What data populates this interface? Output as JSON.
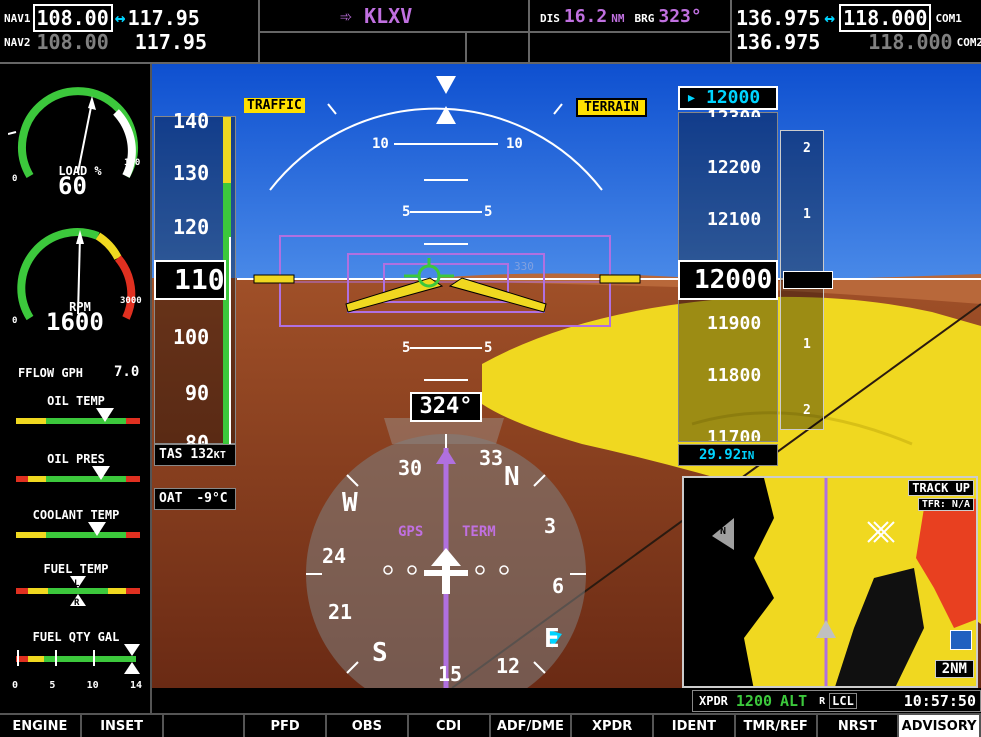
{
  "topbar": {
    "nav1_label": "NAV1",
    "nav1_active": "108.00",
    "nav1_standby": "117.95",
    "nav2_label": "NAV2",
    "nav2_active": "108.00",
    "nav2_standby": "117.95",
    "swap_arrow": "↔",
    "waypoint_arrow": "➾",
    "waypoint": "KLXV",
    "dis_label": "DIS",
    "dis_value": "16.2",
    "dis_unit": "NM",
    "brg_label": "BRG",
    "brg_value": "323°",
    "com1_standby": "136.975",
    "com1_active": "118.000",
    "com1_label": "COM1",
    "com2_standby": "136.975",
    "com2_active": "118.000",
    "com2_label": "COM2"
  },
  "engine": {
    "load_label": "LOAD %",
    "load_value": "60",
    "load_min": "0",
    "load_max": "100",
    "load_fraction": 0.6,
    "rpm_label": "RPM",
    "rpm_value": "1600",
    "rpm_min": "0",
    "rpm_max": "3000",
    "rpm_fraction": 0.53,
    "fflow_label": "FFLOW GPH",
    "fflow_value": "7.0",
    "oil_temp_label": "OIL TEMP",
    "oil_pres_label": "OIL PRES",
    "coolant_label": "COOLANT TEMP",
    "fuel_temp_label": "FUEL TEMP",
    "fuel_qty_label": "FUEL QTY GAL",
    "fuel_ticks": [
      "0",
      "5",
      "10",
      "14"
    ],
    "left_tank": "L",
    "right_tank": "R"
  },
  "pfd": {
    "traffic_label": "TRAFFIC",
    "terrain_label": "TERRAIN",
    "airspeed": "110",
    "airspeed_ticks": [
      "140",
      "130",
      "120",
      "100",
      "90",
      "80"
    ],
    "tas_label": "TAS",
    "tas_value": "132",
    "tas_unit": "KT",
    "oat_label": "OAT",
    "oat_value": "-9°C",
    "pitch_10": "10",
    "pitch_5": "5",
    "heading_marker": "330",
    "selected_alt": "12000",
    "altitude": "12000",
    "alt_ticks": [
      "12300",
      "12200",
      "12100",
      "11900",
      "11800",
      "11700"
    ],
    "vsi_ticks": [
      "2",
      "1",
      "1",
      "2"
    ],
    "baro": "29.92",
    "baro_unit": "IN",
    "heading": "324°",
    "hsi_labels": [
      "N",
      "3",
      "6",
      "E",
      "12",
      "15",
      "S",
      "21",
      "24",
      "W",
      "30",
      "33"
    ],
    "gps_label": "GPS",
    "term_label": "TERM"
  },
  "inset": {
    "mode": "TRACK UP",
    "tfr": "TFR: N/A",
    "range": "2NM",
    "north_label": "N"
  },
  "status": {
    "xpdr_label": "XPDR",
    "xpdr_code": "1200",
    "xpdr_mode": "ALT",
    "r_label": "R",
    "lcl_label": "LCL",
    "time": "10:57:50"
  },
  "softkeys": [
    "ENGINE",
    "INSET",
    "",
    "PFD",
    "OBS",
    "CDI",
    "ADF/DME",
    "XPDR",
    "IDENT",
    "TMR/REF",
    "NRST",
    "ADVISORY"
  ],
  "colors": {
    "sky": "#1560d8",
    "terrain_yellow": "#f0d820",
    "terrain_brown": "#9a4a22",
    "magenta": "#c070e0",
    "cyan": "#00d4ff",
    "green": "#3cc83c"
  }
}
